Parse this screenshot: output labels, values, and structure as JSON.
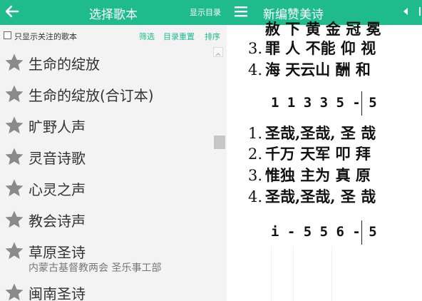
{
  "left_header": {
    "title": "选择歌本",
    "show_dir": "显示目录"
  },
  "filter": {
    "only_followed": "只显示关注的歌本",
    "filter_btn": "筛选",
    "reset_btn": "目录重置",
    "sort_btn": "排序"
  },
  "books": [
    {
      "name": "生命的绽放",
      "sub": ""
    },
    {
      "name": "生命的绽放(合订本)",
      "sub": ""
    },
    {
      "name": "旷野人声",
      "sub": ""
    },
    {
      "name": "灵音诗歌",
      "sub": ""
    },
    {
      "name": "心灵之声",
      "sub": ""
    },
    {
      "name": "教会诗声",
      "sub": ""
    },
    {
      "name": "草原圣诗",
      "sub": "内蒙古基督教两会 圣乐事工部"
    },
    {
      "name": "闽南圣诗",
      "sub": ""
    }
  ],
  "right_header": {
    "title": "新编赞美诗"
  },
  "score": {
    "top_lines": [
      {
        "num": "",
        "text": "赦 下 黄 金 冠 冕"
      },
      {
        "num": "3.",
        "text": "罪 人 不能 仰 视"
      },
      {
        "num": "4.",
        "text": "海 天云山 酬 和"
      }
    ],
    "notes1": "1 1 3 3  5 - 5",
    "mid_lines": [
      {
        "num": "1.",
        "text": "圣哉,圣哉, 圣 哉"
      },
      {
        "num": "2.",
        "text": "千万 天军 叩 拜"
      },
      {
        "num": "3.",
        "text": "惟独 主为 真 原"
      },
      {
        "num": "4.",
        "text": "圣哉,圣哉, 圣 哉"
      }
    ],
    "notes2": "i - 5 5  6 - 5"
  },
  "colors": {
    "accent": "#1fba8e",
    "star": "#8a8a8a"
  },
  "icons": {
    "back": "arrow-left-icon",
    "star": "star-icon",
    "menu": "hamburger-menu-icon",
    "prev": "triangle-left-icon"
  }
}
